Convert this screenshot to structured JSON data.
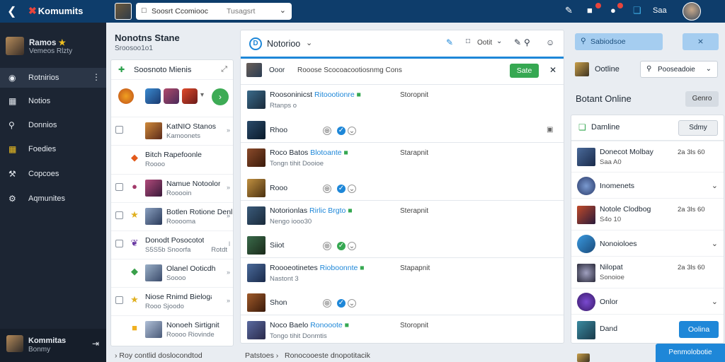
{
  "topbar": {
    "back_icon": "arrow-left-icon",
    "logo_text": "Komumits",
    "search_query": "Soosrt Ccomiooc",
    "search_placeholder": "Tusagsrt",
    "user_label": "Saa",
    "icons": [
      "chat-icon",
      "gift-icon",
      "notification-icon",
      "help-icon"
    ]
  },
  "sidebar": {
    "profile_name": "Ramos",
    "profile_sub": "Vemeos Rlzty",
    "items": [
      {
        "label": "Rotnirios",
        "icon": "dashboard-icon",
        "active": true
      },
      {
        "label": "Notios",
        "icon": "notes-icon",
        "active": false
      },
      {
        "label": "Donnios",
        "icon": "search-icon",
        "active": false
      },
      {
        "label": "Foedies",
        "icon": "grid-icon",
        "active": false
      },
      {
        "label": "Copcoes",
        "icon": "wrench-icon",
        "active": false
      },
      {
        "label": "Aqmunites",
        "icon": "gear-icon",
        "active": false
      }
    ],
    "footer_name": "Kommitas",
    "footer_sub": "Bonmy"
  },
  "left_column": {
    "title": "Nonotns Stane",
    "subtitle": "Sroosoo1o1",
    "panel_title": "Soosnoto Mienis",
    "list": [
      {
        "title": "KatNIO Stanos",
        "sub": "Kamoonets",
        "right": "»",
        "thumb_color": "#8a5a3a",
        "glyph": "",
        "checkbox": true
      },
      {
        "title": "Bitch Rapefoonle",
        "sub": "Roooo",
        "right": "",
        "thumb_color": "",
        "glyph": "◆",
        "glyph_color": "#e35a1b",
        "checkbox": false
      },
      {
        "title": "Namue Notoolor",
        "sub": "Rooooin",
        "right": "»",
        "thumb_color": "#6b2a4a",
        "glyph": "●",
        "glyph_color": "#a33a6a",
        "checkbox": true
      },
      {
        "title": "Botlen Rotione Denline",
        "sub": "Rooooma",
        "right": "»",
        "thumb_color": "#4a6a8a",
        "glyph": "★",
        "glyph_color": "#e0b020",
        "checkbox": true
      },
      {
        "title": "Donodt Posocotot",
        "sub": "S5S5b Snoorfa",
        "right": "l",
        "right2": "Rotdt",
        "thumb_color": "",
        "glyph": "❦",
        "glyph_color": "#6a3aa3",
        "checkbox": true
      },
      {
        "title": "Olanel Ooticdh",
        "sub": "Soooo",
        "right": "»",
        "thumb_color": "#5a7a9a",
        "glyph": "◆",
        "glyph_color": "#3aa04a",
        "checkbox": false
      },
      {
        "title": "Niose Rnimd Bieloga",
        "sub": "Rooo Sjoodo",
        "right": "»",
        "thumb_color": "",
        "glyph": "★",
        "glyph_color": "#e0b020",
        "checkbox": true
      },
      {
        "title": "Nonoeh Sirtignit",
        "sub": "Roooo Riovinde",
        "right": "",
        "thumb_color": "#7a8aa0",
        "glyph": "■",
        "glyph_color": "#f0b020",
        "checkbox": false
      }
    ],
    "footer_text": "Roy contlid doslocondtod"
  },
  "center": {
    "title": "Notorioo",
    "toolbar_label": "Ootit",
    "compose_label": "Ooor",
    "compose_text": "Rooose Scocoacootiosnmg Cons",
    "save_label": "Sate",
    "posts": [
      {
        "author": "Roosoninicst",
        "author_hl": "Ritoootionre",
        "status": "Storopnit",
        "meta": "Rtanps o",
        "action_label": "Rhoo"
      },
      {
        "author": "Roco Batos",
        "author_hl": "Blotoante",
        "status": "Starapnit",
        "meta": "Tongn tihit Dooioe",
        "action_label": "Rooo"
      },
      {
        "author": "Notorionlas",
        "author_hl": "Rirlic Brgto",
        "status": "Sterapnit",
        "meta": "Nengo iooo30",
        "action_label": "Siiot"
      },
      {
        "author": "Roooeotinetes",
        "author_hl": "Rioboonnte",
        "status": "Stapapnit",
        "meta": "Nastont 3",
        "action_label": "Shon"
      },
      {
        "author": "Noco Baelo",
        "author_hl": "Ronooote",
        "status": "Storopnit",
        "meta": "Tongo tihit Donmtis",
        "action_label": ""
      }
    ],
    "breadcrumb": "Patstoes",
    "breadcrumb_tail": "Ronocooeste dnopotitacik"
  },
  "right": {
    "primary_button": "Sabiodsoe",
    "secondary_button": "⨯",
    "online_label": "Ootline",
    "select_value": "Pooseadoie",
    "section_title": "Botant Online",
    "section_button": "Genro",
    "panel_title": "Damline",
    "panel_button": "Sdmy",
    "rows": [
      {
        "title": "Donecot Molbay",
        "sub": "Saa A0",
        "time": "2a 3ls 60",
        "type": "user"
      },
      {
        "title": "Inomenets",
        "sub": "",
        "time": "",
        "type": "expand"
      },
      {
        "title": "Notole Clodbog",
        "sub": "S4o 10",
        "time": "2a 3ls 60",
        "type": "user"
      },
      {
        "title": "Nonoioloes",
        "sub": "",
        "time": "",
        "type": "expand"
      },
      {
        "title": "Nilopat",
        "sub": "Sonoioe",
        "time": "2a 3ls 60",
        "type": "user"
      },
      {
        "title": "Onlor",
        "sub": "",
        "time": "",
        "type": "expand"
      },
      {
        "title": "Dand",
        "sub": "",
        "time": "",
        "type": "button",
        "button": "Oolina"
      }
    ],
    "bottom_cta": "Penmolobotie"
  }
}
